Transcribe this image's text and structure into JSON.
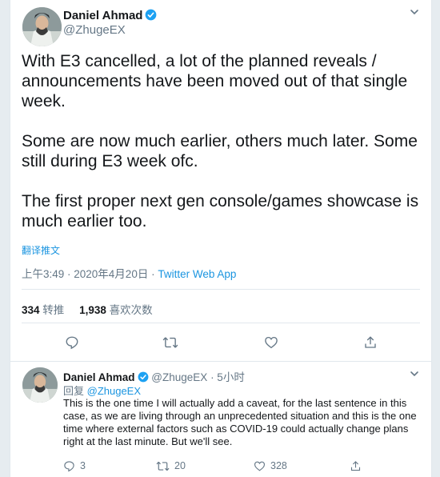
{
  "tweet": {
    "author_name": "Daniel Ahmad",
    "author_handle": "@ZhugeEX",
    "text": "With E3 cancelled, a lot of the planned reveals / announcements have been moved out of that single week.\n\nSome are now much earlier, others much later. Some still during E3 week ofc.\n\nThe first proper next gen console/games showcase is much earlier too.",
    "translate_label": "翻译推文",
    "time": "上午3:49 · 2020年4月20日 · ",
    "source": "Twitter Web App",
    "retweets_count": "334",
    "retweets_label": "转推",
    "likes_count": "1,938",
    "likes_label": "喜欢次数"
  },
  "reply": {
    "author_name": "Daniel Ahmad",
    "author_handle": "@ZhugeEX",
    "time": "· 5小时",
    "reply_prefix": "回复 ",
    "reply_to": "@ZhugeEX",
    "text": "This is the one time I will actually add a caveat, for the last sentence in this case, as we are living through an unprecedented situation and this is the one time where external factors such as COVID-19 could actually change plans right at the last minute. But we'll see.",
    "reply_count": "3",
    "retweet_count": "20",
    "like_count": "328"
  },
  "colors": {
    "accent": "#1da1f2",
    "muted": "#657786",
    "text": "#14171a"
  },
  "icons": [
    "chevron-down-icon",
    "verified-badge-icon",
    "reply-icon",
    "retweet-icon",
    "like-icon",
    "share-icon"
  ]
}
